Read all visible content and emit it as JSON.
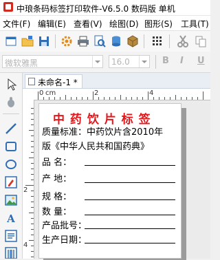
{
  "window": {
    "title": "中琅条码标签打印软件-V6.5.0 数码版 单机"
  },
  "menu": [
    "文件(F)",
    "编辑(E)",
    "查看(V)",
    "绘图(D)",
    "图形(S)",
    "工具(T)"
  ],
  "toolbar": {
    "icons": [
      "new-file-icon",
      "open-folder-icon",
      "save-icon",
      "settings-gear-icon",
      "print-icon",
      "print-preview-icon",
      "database-icon",
      "package-icon",
      "grid-icon",
      "cut-icon",
      "copy-icon"
    ],
    "font_family": "微软雅黑",
    "font_size": "16.0",
    "bold": "B",
    "italic": "I",
    "underline": "U"
  },
  "tools": [
    "select-arrow-icon",
    "pan-icon",
    "line-icon",
    "rectangle-icon",
    "ellipse-icon",
    "image-edit-icon",
    "picture-icon",
    "text-icon",
    "rich-text-icon",
    "barcode-icon"
  ],
  "document": {
    "tab_label": "未命名-1 *"
  },
  "ruler": {
    "h_zero": "0",
    "h_unit": "cm",
    "h_two": "2",
    "h_four": "4",
    "v_two": "2",
    "v_four": "4"
  },
  "label": {
    "title": "中 药 饮 片 标 签",
    "standard_line1": "质量标准：中药饮片含2010年",
    "standard_line2": "版《中华人民共和国药典》",
    "fields": [
      "品    名：",
      "产    地：",
      "规    格：",
      "数    量：",
      "产品批号：",
      "生产日期："
    ]
  },
  "colors": {
    "title_red": "#e5161a",
    "accent": "#d42a1e"
  }
}
